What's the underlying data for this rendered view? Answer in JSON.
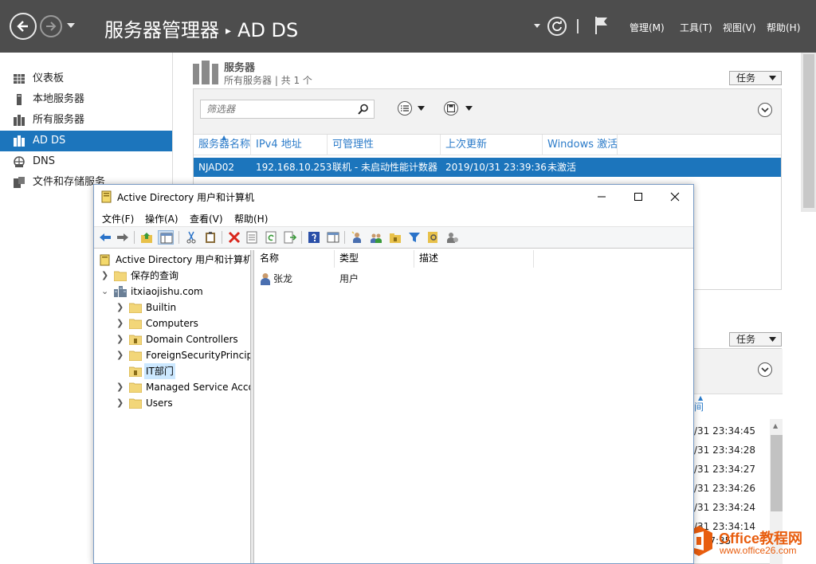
{
  "server_manager": {
    "title": "服务器管理器",
    "title_separator": "▸",
    "page": "AD DS",
    "menus": [
      "管理(M)",
      "工具(T)",
      "视图(V)",
      "帮助(H)"
    ],
    "nav_icons": [
      "back-icon",
      "forward-icon",
      "dropdown-icon",
      "refresh-icon",
      "flag-icon"
    ]
  },
  "sidebar": {
    "items": [
      {
        "label": "仪表板",
        "icon": "dashboard-icon"
      },
      {
        "label": "本地服务器",
        "icon": "local-server-icon"
      },
      {
        "label": "所有服务器",
        "icon": "all-servers-icon"
      },
      {
        "label": "AD DS",
        "icon": "ad-ds-icon",
        "selected": true
      },
      {
        "label": "DNS",
        "icon": "dns-icon"
      },
      {
        "label": "文件和存储服务",
        "icon": "file-storage-icon",
        "has_submenu": true
      }
    ]
  },
  "servers_section": {
    "heading": "服务器",
    "subheading": "所有服务器 | 共 1 个",
    "tasks_label": "任务",
    "filter_placeholder": "筛选器",
    "columns": [
      "服务器名称",
      "IPv4 地址",
      "可管理性",
      "上次更新",
      "Windows 激活"
    ],
    "rows": [
      {
        "name": "NJAD02",
        "ipv4": "192.168.10.253",
        "manageability": "联机 - 未启动性能计数器",
        "last_update": "2019/10/31 23:39:36",
        "activation": "未激活"
      }
    ]
  },
  "events_section": {
    "tasks_label": "任务",
    "visible_column_fragment": "间",
    "times": [
      "/31 23:34:45",
      "/31 23:34:28",
      "/31 23:34:27",
      "/31 23:34:26",
      "/31 23:34:24",
      "/31 23:34:14",
      "3:07:35"
    ]
  },
  "watermark": {
    "brand": "Office教程网",
    "url": "www.office26.com",
    "brand_color": "#e85d0e"
  },
  "aduc": {
    "title": "Active Directory 用户和计算机",
    "menus": [
      "文件(F)",
      "操作(A)",
      "查看(V)",
      "帮助(H)"
    ],
    "tree": {
      "root": "Active Directory 用户和计算机",
      "saved_queries": "保存的查询",
      "domain": "itxiaojishu.com",
      "containers": [
        {
          "label": "Builtin",
          "icon": "folder-icon",
          "expandable": true
        },
        {
          "label": "Computers",
          "icon": "folder-icon",
          "expandable": true
        },
        {
          "label": "Domain Controllers",
          "icon": "ou-folder-icon",
          "expandable": true
        },
        {
          "label": "ForeignSecurityPrincipals",
          "icon": "folder-icon",
          "expandable": true
        },
        {
          "label": "IT部门",
          "icon": "ou-folder-icon",
          "expandable": false,
          "selected": true
        },
        {
          "label": "Managed Service Accounts",
          "icon": "folder-icon",
          "expandable": true
        },
        {
          "label": "Users",
          "icon": "folder-icon",
          "expandable": true
        }
      ]
    },
    "list": {
      "columns": [
        "名称",
        "类型",
        "描述"
      ],
      "rows": [
        {
          "name": "张龙",
          "type": "用户",
          "description": ""
        }
      ]
    }
  },
  "colors": {
    "header_bg": "#4d4d4d",
    "selection_blue": "#1c75bc",
    "column_header_blue": "#2b7bc9",
    "tree_selected_bg": "#cce8ff"
  }
}
